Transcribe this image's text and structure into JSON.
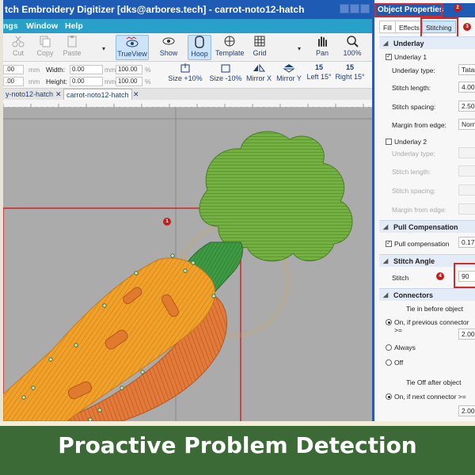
{
  "window": {
    "title": "tch Embroidery Digitizer [dks@arbores.tech] - carrot-noto12-hatch"
  },
  "menu": {
    "items": [
      "ngs",
      "Window",
      "Help"
    ]
  },
  "toolbar": {
    "cut": "Cut",
    "copy": "Copy",
    "paste": "Paste",
    "trueview": "TrueView",
    "show": "Show",
    "hoop": "Hoop",
    "template": "Template",
    "grid": "Grid",
    "pan": "Pan",
    "zoom": "100%"
  },
  "props": {
    "x_value": ".00",
    "x_unit": "mm",
    "width_label": "Width:",
    "width_value": "0.00",
    "width_unit": "mm",
    "width_pct": "100.00",
    "pct1": "%",
    "y_value": ".00",
    "y_unit": "mm",
    "height_label": "Height:",
    "height_value": "0.00",
    "height_unit": "mm",
    "height_pct": "100.00",
    "pct2": "%",
    "size_up": "Size +10%",
    "size_down": "Size -10%",
    "mirror_x": "Mirror X",
    "mirror_y": "Mirror Y",
    "left15": "Left 15°",
    "right15": "Right 15°",
    "rot_left_val": "15",
    "rot_right_val": "15"
  },
  "tabs": {
    "tab1": "y-noto12-hatch",
    "tab2": "carrot-noto12-hatch"
  },
  "markers": {
    "m1": "1",
    "m2": "2",
    "m3": "3",
    "m4": "4"
  },
  "panel": {
    "title": "Object Properties",
    "tabs": [
      "Fill",
      "Effects",
      "Stitching"
    ],
    "underlay": {
      "heading": "Underlay",
      "u1_label": "Underlay 1",
      "type_label": "Underlay type:",
      "type_value": "Tatami",
      "length_label": "Stitch length:",
      "length_value": "4.00",
      "spacing_label": "Stitch spacing:",
      "spacing_value": "2.50",
      "margin_label": "Margin from edge:",
      "margin_value": "Normal",
      "u2_label": "Underlay 2",
      "type2_label": "Underlay type:",
      "length2_label": "Stitch length:",
      "spacing2_label": "Stitch spacing:",
      "margin2_label": "Margin from edge:"
    },
    "pull": {
      "heading": "Pull Compensation",
      "label": "Pull compensation",
      "value": "0.17"
    },
    "angle": {
      "heading": "Stitch Angle",
      "label": "Stitch",
      "value": "90"
    },
    "connectors": {
      "heading": "Connectors",
      "tiein": "Tie in before object",
      "opt1": "On, if previous connector >=",
      "opt1_value": "2.00",
      "opt2": "Always",
      "opt3": "Off",
      "tieoff": "Tie Off after object",
      "opt4": "On, if next connector >=",
      "opt4_value": "2.00"
    }
  },
  "banner": {
    "text": "Proactive Problem Detection"
  },
  "colors": {
    "accent": "#1e5bb5",
    "menu": "#29a0c9",
    "banner": "#3c6a37",
    "highlight": "#d42a2a",
    "carrot": "#f2a02a",
    "leaf": "#6fae3c"
  }
}
